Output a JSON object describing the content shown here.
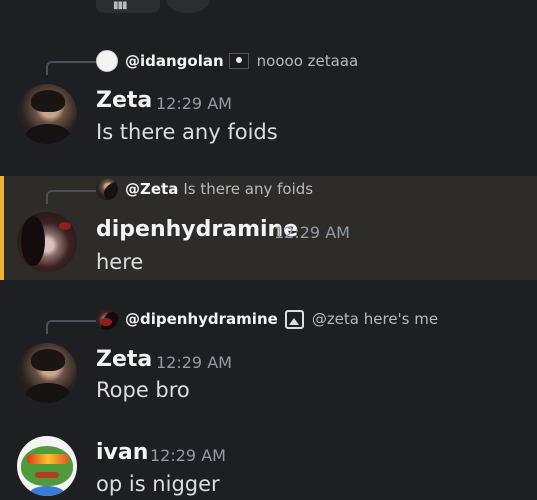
{
  "colors": {
    "background": "#1e1f22",
    "highlight_bg": "#2e2c28",
    "mention_bar": "#f0b232",
    "username": "#f2f3f5",
    "timestamp": "#949ba4",
    "text": "#dbdee1"
  },
  "messages": [
    {
      "reply": {
        "user": "@idangolan",
        "flag_icon": "pirate-flag-icon",
        "text": "noooo zetaaa"
      },
      "author": "Zeta",
      "time": "12:29 AM",
      "content": "Is there any foids"
    },
    {
      "highlighted": true,
      "reply": {
        "user": "@Zeta",
        "text": "Is there any foids"
      },
      "author": "dipenhydramine",
      "time": "12:29 AM",
      "content": "here"
    },
    {
      "reply": {
        "user": "@dipenhydramine",
        "attachment_icon": "image-icon",
        "text": "@zeta here's me"
      },
      "author": "Zeta",
      "time": "12:29 AM",
      "content": "Rope bro"
    },
    {
      "author": "ivan",
      "time": "12:29 AM",
      "content": "op is nigger"
    }
  ]
}
